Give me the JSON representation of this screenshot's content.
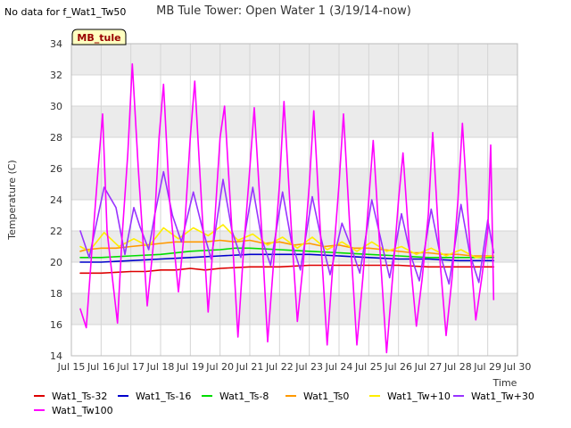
{
  "no_data_note": "No data for f_Wat1_Tw50",
  "chart_data": {
    "type": "line",
    "title": "MB Tule Tower: Open Water 1 (3/19/14-now)",
    "xlabel": "Time",
    "ylabel": "Temperature (C)",
    "tag_label": "MB_tule",
    "xlim": [
      15,
      30
    ],
    "ylim": [
      14,
      34
    ],
    "x_ticks": [
      15,
      16,
      17,
      18,
      19,
      20,
      21,
      22,
      23,
      24,
      25,
      26,
      27,
      28,
      29,
      30
    ],
    "x_tick_labels": [
      "Jul 15",
      "Jul 16",
      "Jul 17",
      "Jul 18",
      "Jul 19",
      "Jul 20",
      "Jul 21",
      "Jul 22",
      "Jul 23",
      "Jul 24",
      "Jul 25",
      "Jul 26",
      "Jul 27",
      "Jul 28",
      "Jul 29",
      "Jul 30"
    ],
    "y_ticks": [
      14,
      16,
      18,
      20,
      22,
      24,
      26,
      28,
      30,
      32,
      34
    ],
    "y_tick_labels": [
      "14",
      "16",
      "18",
      "20",
      "22",
      "24",
      "26",
      "28",
      "30",
      "32",
      "34"
    ],
    "grid": true,
    "legend_position": "bottom",
    "series": [
      {
        "name": "Wat1_Ts-32",
        "color": "#dd0000",
        "x": [
          15.3,
          16,
          17,
          17.5,
          18,
          18.5,
          19,
          19.5,
          20,
          21,
          22,
          23,
          24,
          25,
          26,
          27,
          28,
          29.2
        ],
        "y": [
          19.3,
          19.3,
          19.4,
          19.4,
          19.5,
          19.5,
          19.6,
          19.5,
          19.6,
          19.7,
          19.7,
          19.8,
          19.8,
          19.8,
          19.8,
          19.7,
          19.7,
          19.7
        ]
      },
      {
        "name": "Wat1_Ts-16",
        "color": "#0000cc",
        "x": [
          15.3,
          16,
          17,
          18,
          19,
          20,
          21,
          22,
          23,
          24,
          25,
          26,
          27,
          28,
          29.2
        ],
        "y": [
          20.0,
          20.0,
          20.1,
          20.2,
          20.3,
          20.4,
          20.5,
          20.5,
          20.5,
          20.4,
          20.3,
          20.2,
          20.2,
          20.1,
          20.1
        ]
      },
      {
        "name": "Wat1_Ts-8",
        "color": "#00dd00",
        "x": [
          15.3,
          16,
          17,
          18,
          19,
          20,
          20.5,
          21,
          22,
          23,
          24,
          25,
          26,
          27,
          28,
          29.2
        ],
        "y": [
          20.3,
          20.3,
          20.4,
          20.5,
          20.7,
          20.8,
          20.9,
          20.9,
          20.8,
          20.7,
          20.6,
          20.5,
          20.4,
          20.3,
          20.3,
          20.3
        ]
      },
      {
        "name": "Wat1_Ts0",
        "color": "#ff9900",
        "x": [
          15.3,
          15.5,
          16,
          16.5,
          17,
          17.5,
          18,
          18.5,
          19,
          19.5,
          20,
          20.5,
          21,
          21.5,
          22,
          22.5,
          23,
          23.5,
          24,
          24.5,
          25,
          25.5,
          26,
          26.5,
          27,
          27.5,
          28,
          28.5,
          29.2
        ],
        "y": [
          20.7,
          20.8,
          20.9,
          20.9,
          21.0,
          21.1,
          21.2,
          21.3,
          21.3,
          21.3,
          21.4,
          21.3,
          21.4,
          21.2,
          21.3,
          21.1,
          21.2,
          21.0,
          21.1,
          20.9,
          20.9,
          20.8,
          20.7,
          20.6,
          20.6,
          20.5,
          20.5,
          20.4,
          20.4
        ]
      },
      {
        "name": "Wat1_Tw+10",
        "color": "#ffee00",
        "x": [
          15.3,
          15.6,
          16.1,
          16.6,
          17.1,
          17.6,
          18.1,
          18.6,
          19.1,
          19.6,
          20.1,
          20.6,
          21.1,
          21.6,
          22.1,
          22.6,
          23.1,
          23.6,
          24.1,
          24.6,
          25.1,
          25.6,
          26.1,
          26.6,
          27.1,
          27.6,
          28.1,
          28.6,
          29.2
        ],
        "y": [
          21.0,
          20.7,
          21.9,
          21.0,
          21.5,
          21.0,
          22.2,
          21.5,
          22.2,
          21.7,
          22.4,
          21.4,
          21.8,
          21.1,
          21.6,
          20.9,
          21.6,
          20.8,
          21.3,
          20.7,
          21.3,
          20.7,
          21.0,
          20.5,
          20.9,
          20.4,
          20.8,
          20.3,
          20.4
        ]
      },
      {
        "name": "Wat1_Tw+30",
        "color": "#9933ff",
        "x": [
          15.3,
          15.6,
          15.9,
          16.1,
          16.5,
          16.8,
          17.1,
          17.3,
          17.6,
          17.8,
          18.1,
          18.4,
          18.7,
          19.1,
          19.4,
          19.7,
          20.1,
          20.4,
          20.7,
          21.1,
          21.4,
          21.7,
          22.1,
          22.4,
          22.7,
          23.1,
          23.4,
          23.7,
          24.1,
          24.4,
          24.7,
          25.1,
          25.4,
          25.7,
          26.1,
          26.4,
          26.7,
          27.1,
          27.4,
          27.7,
          28.1,
          28.4,
          28.7,
          29.0,
          29.2
        ],
        "y": [
          22.0,
          20.3,
          23.0,
          24.8,
          23.5,
          20.5,
          23.5,
          22.3,
          20.8,
          23.0,
          25.8,
          23.0,
          21.3,
          24.5,
          22.2,
          20.2,
          25.3,
          22.0,
          20.3,
          24.8,
          21.5,
          19.8,
          24.5,
          21.3,
          19.5,
          24.2,
          21.5,
          19.2,
          22.5,
          21.0,
          19.3,
          24.0,
          21.5,
          19.0,
          23.1,
          20.5,
          18.8,
          23.4,
          20.5,
          18.6,
          23.7,
          20.5,
          18.7,
          22.7,
          20.6
        ]
      },
      {
        "name": "Wat1_Tw100",
        "color": "#ff00ff",
        "x": [
          15.3,
          15.5,
          15.7,
          15.9,
          16.05,
          16.2,
          16.55,
          16.7,
          16.9,
          17.05,
          17.25,
          17.55,
          17.75,
          17.95,
          18.1,
          18.3,
          18.6,
          18.8,
          19.0,
          19.15,
          19.4,
          19.6,
          19.8,
          20.0,
          20.15,
          20.4,
          20.6,
          20.8,
          21.0,
          21.15,
          21.4,
          21.6,
          21.8,
          22.0,
          22.15,
          22.4,
          22.6,
          22.8,
          23.0,
          23.15,
          23.4,
          23.6,
          23.8,
          24.0,
          24.15,
          24.4,
          24.6,
          24.8,
          25.0,
          25.15,
          25.4,
          25.6,
          25.8,
          26.0,
          26.15,
          26.4,
          26.6,
          26.8,
          27.0,
          27.15,
          27.4,
          27.6,
          27.8,
          28.0,
          28.15,
          28.4,
          28.6,
          28.8,
          29.0,
          29.1,
          29.2
        ],
        "y": [
          17.0,
          15.8,
          21.0,
          26.0,
          29.5,
          22.0,
          16.1,
          21.5,
          27.0,
          32.7,
          26.0,
          17.2,
          21.0,
          28.0,
          31.4,
          24.0,
          18.1,
          22.0,
          28.0,
          31.6,
          23.0,
          16.8,
          22.0,
          28.0,
          30.0,
          22.0,
          15.2,
          21.0,
          26.0,
          29.9,
          22.0,
          14.9,
          20.0,
          25.0,
          30.3,
          22.0,
          16.2,
          20.0,
          25.0,
          29.7,
          21.0,
          14.7,
          20.0,
          25.0,
          29.5,
          21.0,
          14.7,
          19.0,
          24.0,
          27.8,
          20.0,
          14.2,
          19.0,
          24.0,
          27.0,
          20.0,
          15.9,
          19.0,
          23.0,
          28.3,
          20.0,
          15.3,
          19.0,
          24.0,
          28.9,
          21.0,
          16.3,
          19.0,
          22.0,
          27.5,
          17.6
        ]
      }
    ]
  }
}
